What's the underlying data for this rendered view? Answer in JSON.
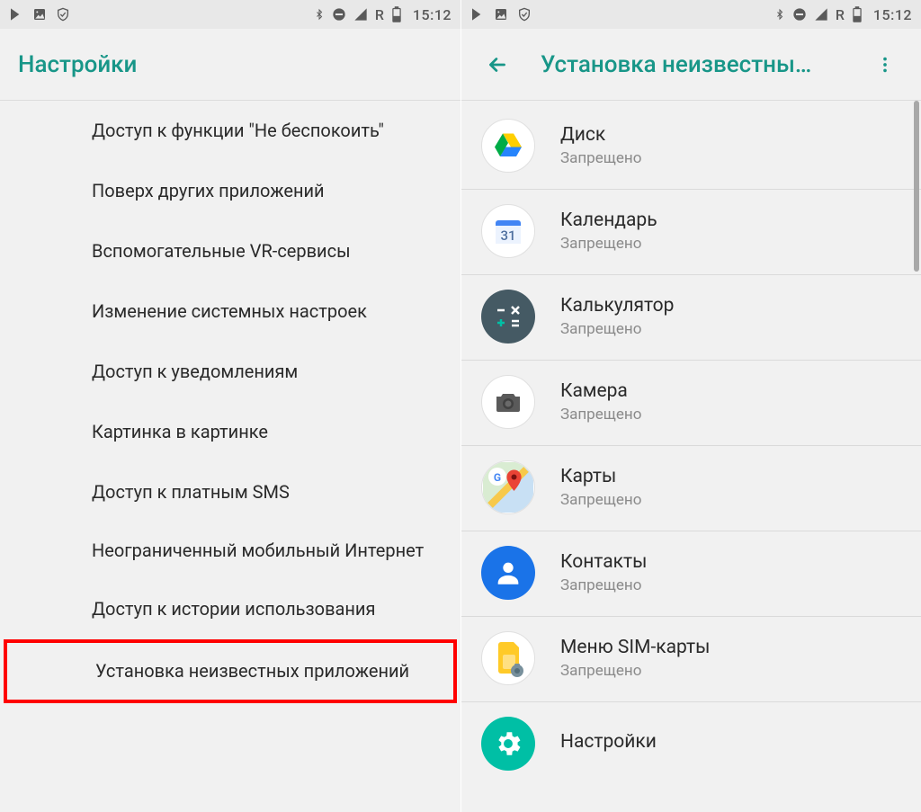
{
  "status": {
    "time": "15:12",
    "roaming": "R"
  },
  "left": {
    "title": "Настройки",
    "items": [
      "Доступ к функции \"Не беспокоить\"",
      "Поверх других приложений",
      "Вспомогательные VR-сервисы",
      "Изменение системных настроек",
      "Доступ к уведомлениям",
      "Картинка в картинке",
      "Доступ к платным SMS",
      "Неограниченный мобильный Интернет",
      "Доступ к истории использования",
      "Установка неизвестных приложений"
    ]
  },
  "right": {
    "title": "Установка неизвестны…",
    "status_denied": "Запрещено",
    "apps": [
      {
        "name": "Диск",
        "icon": "drive"
      },
      {
        "name": "Календарь",
        "icon": "calendar"
      },
      {
        "name": "Калькулятор",
        "icon": "calculator"
      },
      {
        "name": "Камера",
        "icon": "camera"
      },
      {
        "name": "Карты",
        "icon": "maps"
      },
      {
        "name": "Контакты",
        "icon": "contacts"
      },
      {
        "name": "Меню SIM-карты",
        "icon": "sim"
      },
      {
        "name": "Настройки",
        "icon": "settings"
      }
    ]
  }
}
